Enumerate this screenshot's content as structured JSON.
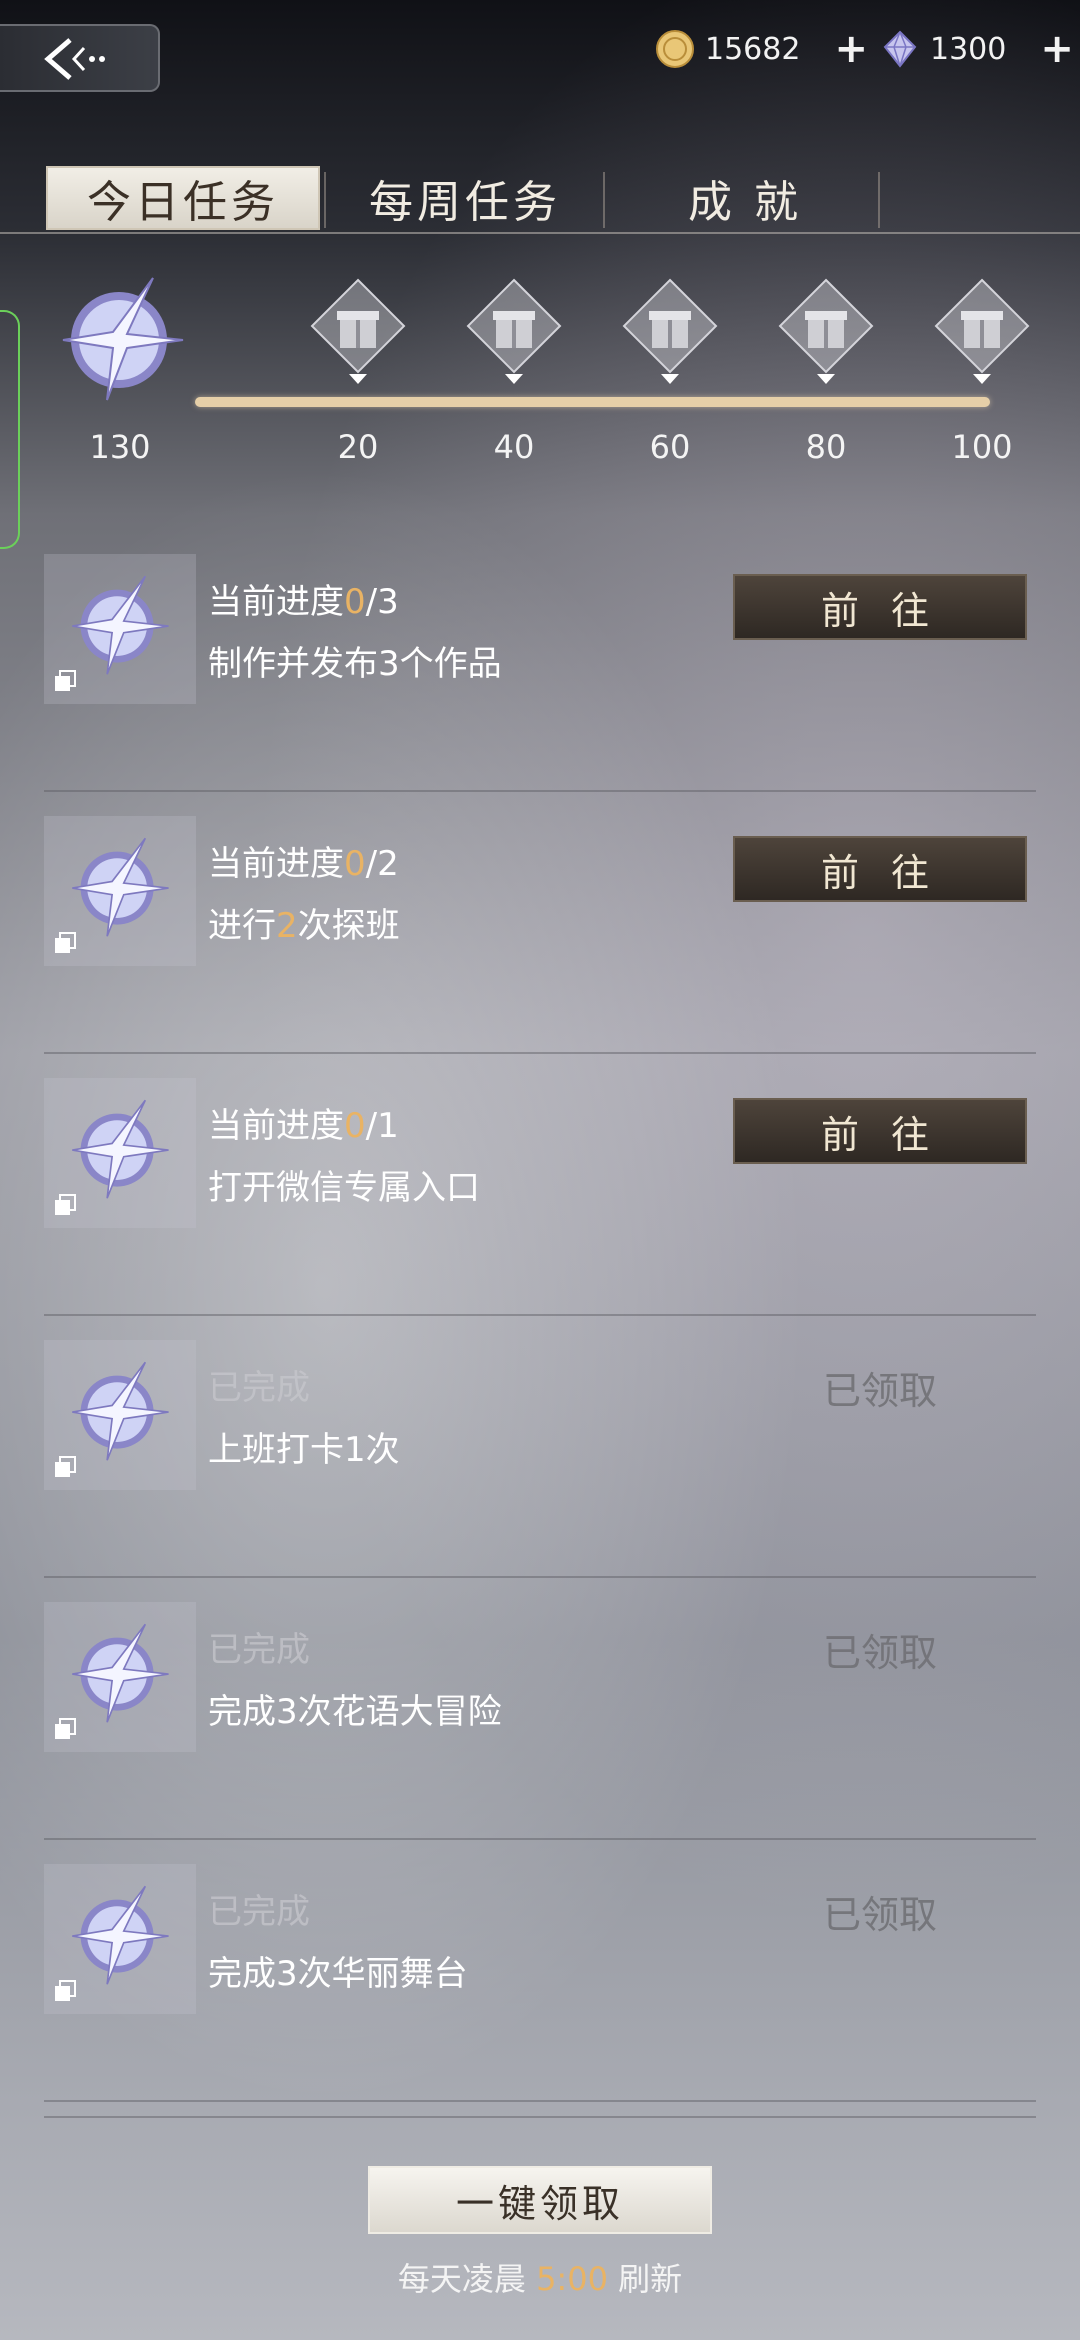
{
  "header": {
    "coin_amount": "15682",
    "gem_amount": "1300",
    "plus": "+"
  },
  "tabs": [
    {
      "label": "今日任务",
      "active": true
    },
    {
      "label": "每周任务",
      "active": false
    },
    {
      "label": "成 就",
      "active": false
    }
  ],
  "milestones": {
    "current_points": "130",
    "progress": 1.0,
    "labels": [
      "20",
      "40",
      "60",
      "80",
      "100"
    ]
  },
  "tasks": [
    {
      "status_prefix": "当前进度",
      "progress_done": "0",
      "progress_total": "/3",
      "desc": "制作并发布3个作品",
      "action": "前 往"
    },
    {
      "status_prefix": "当前进度",
      "progress_done": "0",
      "progress_total": "/2",
      "desc_pre": "进行",
      "desc_num": "2",
      "desc_post": "次探班",
      "action": "前 往"
    },
    {
      "status_prefix": "当前进度",
      "progress_done": "0",
      "progress_total": "/1",
      "desc": "打开微信专属入口",
      "action": "前 往"
    },
    {
      "status": "已完成",
      "desc": "上班打卡1次",
      "action": "已领取"
    },
    {
      "status": "已完成",
      "desc": "完成3次花语大冒险",
      "action": "已领取"
    },
    {
      "status": "已完成",
      "desc": "完成3次华丽舞台",
      "action": "已领取"
    }
  ],
  "footer": {
    "claim_all": "一键领取",
    "refresh_pre": "每天凌晨 ",
    "refresh_time": "5:00",
    "refresh_post": " 刷新"
  },
  "colors": {
    "highlight": "#e9b364",
    "progress_bar": "#e6cfa8",
    "button_dark": "#3a332c"
  },
  "icons": [
    "back-arrow-icon",
    "gold-coin-icon",
    "diamond-gem-icon",
    "star-badge-icon",
    "gift-box-icon",
    "copy-icon"
  ]
}
